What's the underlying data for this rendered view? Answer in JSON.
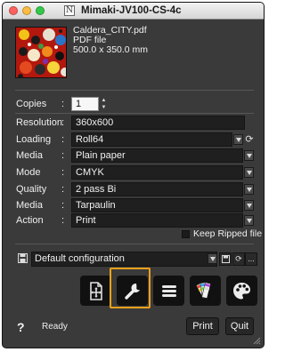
{
  "window": {
    "title": "Mimaki-JV100-CS-4c",
    "app_badge": "N"
  },
  "file": {
    "name": "Caldera_CITY.pdf",
    "type": "PDF file",
    "size": "500.0 x 350.0 mm"
  },
  "settings": {
    "copies": {
      "label": "Copies",
      "value": "1"
    },
    "resolution": {
      "label": "Resolution",
      "value": "360x600"
    },
    "loading": {
      "label": "Loading",
      "value": "Roll64"
    },
    "media": {
      "label": "Media",
      "value": "Plain paper"
    },
    "mode": {
      "label": "Mode",
      "value": "CMYK"
    },
    "quality": {
      "label": "Quality",
      "value": "2 pass Bi"
    },
    "media2": {
      "label": "Media",
      "value": "Tarpaulin"
    },
    "action": {
      "label": "Action",
      "value": "Print"
    }
  },
  "colon": ":",
  "keep_ripped": {
    "label": "Keep Ripped file",
    "checked": false
  },
  "configuration": {
    "value": "Default configuration",
    "more": "..."
  },
  "toolbar": {
    "items": [
      "layout-icon",
      "wrench-icon",
      "menu-icon",
      "color-swatches-icon",
      "palette-icon"
    ],
    "selected": "wrench-icon"
  },
  "footer": {
    "help": "?",
    "status": "Ready",
    "print": "Print",
    "quit": "Quit"
  },
  "colors": {
    "panel": "#3a3a3a",
    "field": "#1f1f1f",
    "highlight": "#f0a11a",
    "tool_bg": "#111111"
  }
}
